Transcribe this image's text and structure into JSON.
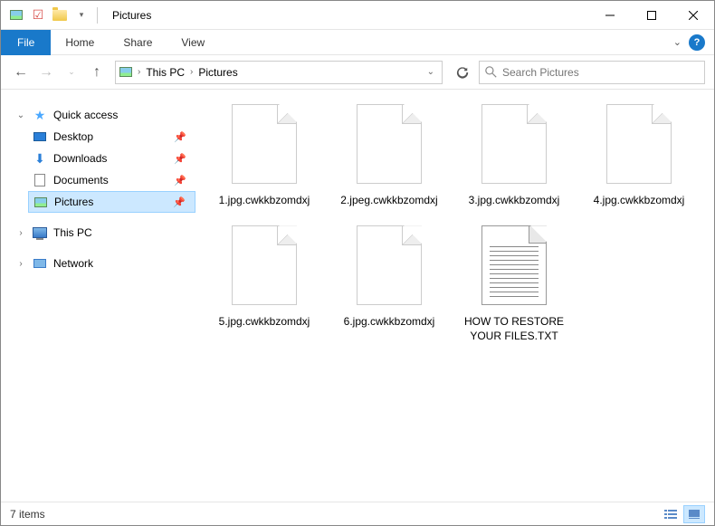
{
  "window": {
    "title": "Pictures"
  },
  "ribbon": {
    "file": "File",
    "tabs": [
      "Home",
      "Share",
      "View"
    ]
  },
  "address": {
    "crumbs": [
      "This PC",
      "Pictures"
    ]
  },
  "search": {
    "placeholder": "Search Pictures"
  },
  "sidebar": {
    "quickAccess": "Quick access",
    "items": [
      {
        "label": "Desktop",
        "icon": "desktop",
        "pinned": true
      },
      {
        "label": "Downloads",
        "icon": "downloads",
        "pinned": true
      },
      {
        "label": "Documents",
        "icon": "documents",
        "pinned": true
      },
      {
        "label": "Pictures",
        "icon": "pictures",
        "pinned": true,
        "selected": true
      }
    ],
    "thisPC": "This PC",
    "network": "Network"
  },
  "files": [
    {
      "name": "1.jpg.cwkkbzomdxj",
      "type": "blank"
    },
    {
      "name": "2.jpeg.cwkkbzomdxj",
      "type": "blank"
    },
    {
      "name": "3.jpg.cwkkbzomdxj",
      "type": "blank"
    },
    {
      "name": "4.jpg.cwkkbzomdxj",
      "type": "blank"
    },
    {
      "name": "5.jpg.cwkkbzomdxj",
      "type": "blank"
    },
    {
      "name": "6.jpg.cwkkbzomdxj",
      "type": "blank"
    },
    {
      "name": "HOW TO RESTORE YOUR FILES.TXT",
      "type": "text"
    }
  ],
  "status": {
    "count": "7 items"
  }
}
